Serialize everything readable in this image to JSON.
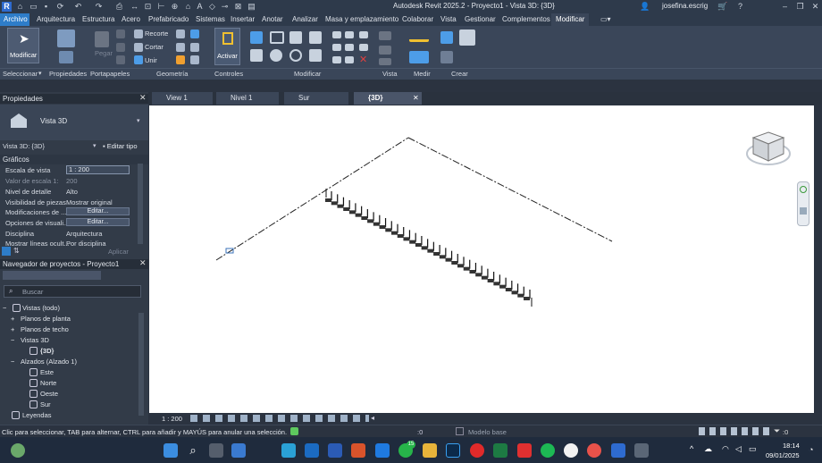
{
  "titlebar": {
    "title": "Autodesk Revit 2025.2 - Proyecto1 - Vista 3D: {3D}",
    "user": "josefina.escrig"
  },
  "tabs": [
    "Archivo",
    "Arquitectura",
    "Estructura",
    "Acero",
    "Prefabricado",
    "Sistemas",
    "Insertar",
    "Anotar",
    "Analizar",
    "Masa y emplazamiento",
    "Colaborar",
    "Vista",
    "Gestionar",
    "Complementos",
    "Modificar"
  ],
  "ribbon": {
    "modificar_btn": "Modificar",
    "recorte": "Recorte",
    "cortar": "Cortar",
    "unir": "Unir",
    "pegar": "Pegar",
    "activar": "Activar",
    "panels": [
      "Seleccionar",
      "Propiedades",
      "Portapapeles",
      "Geometría",
      "Controles",
      "Modificar",
      "Vista",
      "Medir",
      "Crear"
    ]
  },
  "properties": {
    "header": "Propiedades",
    "type_name": "Vista 3D",
    "selector": "Vista 3D: {3D}",
    "edit_type": "Editar tipo",
    "section": "Gráficos",
    "rows": [
      {
        "label": "Escala de vista",
        "value": "1 : 200"
      },
      {
        "label": "Valor de escala    1:",
        "value": "200"
      },
      {
        "label": "Nivel de detalle",
        "value": "Alto"
      },
      {
        "label": "Visibilidad de piezas",
        "value": "Mostrar original"
      },
      {
        "label": "Modificaciones de ...",
        "value": "Editar..."
      },
      {
        "label": "Opciones de visuali...",
        "value": "Editar..."
      },
      {
        "label": "Disciplina",
        "value": "Arquitectura"
      },
      {
        "label": "Mostrar líneas ocult...",
        "value": "Por disciplina"
      }
    ],
    "apply": "Aplicar"
  },
  "browser": {
    "header": "Navegador de proyectos - Proyecto1",
    "search_placeholder": "Buscar",
    "items": [
      {
        "label": "Vistas (todo)"
      },
      {
        "label": "Planos de planta"
      },
      {
        "label": "Planos de techo"
      },
      {
        "label": "Vistas 3D"
      },
      {
        "label": "{3D}"
      },
      {
        "label": "Alzados (Alzado 1)"
      },
      {
        "label": "Este"
      },
      {
        "label": "Norte"
      },
      {
        "label": "Oeste"
      },
      {
        "label": "Sur"
      },
      {
        "label": "Leyendas"
      }
    ]
  },
  "viewtabs": [
    "View 1",
    "Nivel 1",
    "Sur",
    "{3D}"
  ],
  "viewbar": {
    "scale": "1 : 200"
  },
  "statusbar": {
    "message": "Clic para seleccionar, TAB para alternar, CTRL para añadir y MAYÚS para anular una selección.",
    "count": ":0",
    "model": "Modelo base",
    "filter": ":0"
  },
  "taskbar": {
    "time": "18:14",
    "date": "09/01/2025",
    "badge": "15"
  },
  "colors": {
    "accent": "#2e7dc9",
    "active_tab": "#3d4a5e"
  }
}
